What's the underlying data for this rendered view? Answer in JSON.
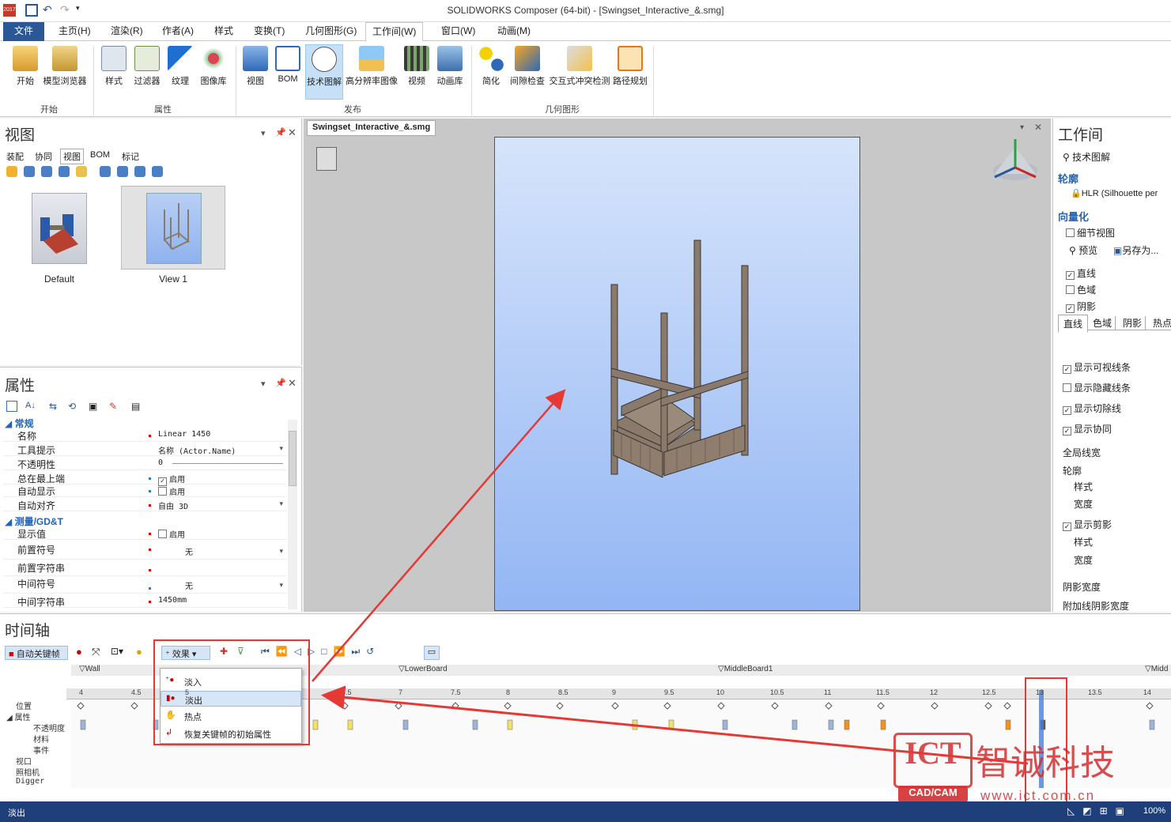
{
  "app": {
    "title": "SOLIDWORKS Composer (64-bit) - [Swingset_Interactive_&.smg]",
    "year_badge": "2017"
  },
  "menu": [
    "文件",
    "主页(H)",
    "渲染(R)",
    "作者(A)",
    "样式",
    "变换(T)",
    "几何图形(G)",
    "工作间(W)",
    "窗口(W)",
    "动画(M)"
  ],
  "ribbon": {
    "buttons": [
      "开始",
      "模型浏览器",
      "样式",
      "过滤器",
      "纹理",
      "图像库",
      "视图",
      "BOM",
      "技术图解",
      "高分辨率图像",
      "视频",
      "动画库",
      "简化",
      "间隙检查",
      "交互式冲突检测",
      "路径规划"
    ],
    "groups": [
      "开始",
      "属性",
      "发布",
      "几何图形"
    ]
  },
  "view_panel": {
    "title": "视图",
    "tabs": [
      "装配",
      "协同",
      "视图",
      "BOM",
      "标记"
    ],
    "thumbs": [
      "Default",
      "View 1"
    ]
  },
  "props_panel": {
    "title": "属性",
    "sections": [
      "常规",
      "测量/GD&T"
    ],
    "rows": [
      {
        "k": "名称",
        "v": "Linear 1450"
      },
      {
        "k": "工具提示",
        "v": "名称 (Actor.Name)"
      },
      {
        "k": "不透明性",
        "v": "0"
      },
      {
        "k": "总在最上端",
        "v": "启用"
      },
      {
        "k": "自动显示",
        "v": "启用"
      },
      {
        "k": "自动对齐",
        "v": "自由 3D"
      },
      {
        "k": "显示值",
        "v": "启用"
      },
      {
        "k": "前置符号",
        "v": "无"
      },
      {
        "k": "前置字符串",
        "v": ""
      },
      {
        "k": "中间符号",
        "v": "无"
      },
      {
        "k": "中间字符串",
        "v": "1450mm"
      }
    ]
  },
  "viewport": {
    "tab": "Swingset_Interactive_&.smg"
  },
  "right_panel": {
    "title": "工作间",
    "mode": "技术图解",
    "outline_head": "轮廓",
    "outline_value": "HLR (Silhouette per",
    "vector_head": "向量化",
    "detail_view": "细节视图",
    "preview": "预览",
    "save_as": "另存为...",
    "checks": [
      "直线",
      "色域",
      "阴影"
    ],
    "subtabs": [
      "直线",
      "色域",
      "阴影",
      "热点"
    ],
    "line_opts": [
      "显示可视线条",
      "显示隐藏线条",
      "显示切除线",
      "显示协同"
    ],
    "global_width": "全局线宽",
    "outline": "轮廓",
    "style": "样式",
    "width": "宽度",
    "show_clip": "显示剪影",
    "style2": "样式",
    "width2": "宽度",
    "shadow_width": "阴影宽度",
    "extra_shadow": "附加线阴影宽度"
  },
  "timeline": {
    "title": "时间轴",
    "auto_key": "自动关键帧",
    "effects": "效果",
    "menu": [
      "淡入",
      "淡出",
      "热点",
      "恢复关键帧的初始属性"
    ],
    "tracks": [
      "位置",
      "属性",
      "不透明度",
      "材料",
      "事件",
      "视口",
      "照相机",
      "Digger"
    ],
    "markers": [
      "Wall",
      "LowerBoard",
      "MiddleBoard1",
      "Midd"
    ],
    "ticks": [
      "4",
      "4.5",
      "5",
      "6.5",
      "7",
      "7.5",
      "8",
      "8.5",
      "9",
      "9.5",
      "10",
      "10.5",
      "11",
      "11.5",
      "12",
      "12.5",
      "13",
      "13.5",
      "14"
    ]
  },
  "status": {
    "text": "淡出",
    "zoom": "100%"
  },
  "watermark": {
    "brand": "ICT智诚科技",
    "sub": "CAD/CAM",
    "url": "www.ict.com.cn"
  }
}
